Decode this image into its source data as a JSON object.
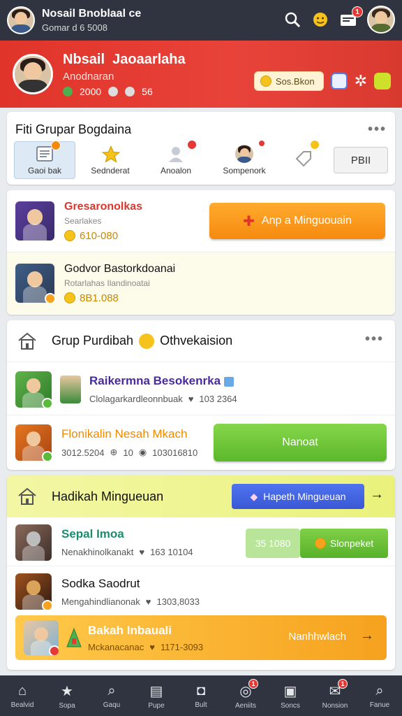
{
  "topbar": {
    "user_name": "Nosail Bnoblaal ce",
    "user_sub": "Gomar d 6 5008",
    "notif_count": "1",
    "icons": [
      "search-icon",
      "emoji-icon",
      "inbox-icon",
      "avatar"
    ]
  },
  "profile": {
    "name": "Nbsail  Jaoaarlaha",
    "subtitle": "Anodnaran",
    "stat1": "2000",
    "stat2": "56",
    "points_label": "Sos.Bkon"
  },
  "section1": {
    "title": "Fiti Grupar Bogdaina",
    "categories": [
      {
        "label": "Gaoi bak",
        "icon": "list-icon",
        "badge": true
      },
      {
        "label": "Sednderat",
        "icon": "star-icon",
        "badge": false
      },
      {
        "label": "Anoalon",
        "icon": "user-icon",
        "badge": true
      },
      {
        "label": "Sompenork",
        "icon": "profile-icon",
        "badge": true
      },
      {
        "label": "",
        "icon": "tag-icon",
        "badge": true
      }
    ],
    "filter_label": "PBII"
  },
  "section2": {
    "row1": {
      "title": "Gresaronolkas",
      "sub": "Searlakes",
      "coins": "610-080",
      "button": "Anp a Minguouain"
    },
    "row2": {
      "title": "Godvor Bastorkdoanai",
      "sub": "Rotarlahas Ilandinoatai",
      "coins": "8B1.088"
    }
  },
  "section3": {
    "title": "Grup Purdibah",
    "title_suffix": "Othvekaision",
    "row1": {
      "title": "Raikermna Besokenrka",
      "sub": "Clolagarkardleonnbuak",
      "value": "103 2364"
    },
    "row2": {
      "title": "Flonikalin Nesah Mkach",
      "value1": "3012.5204",
      "value2": "10",
      "value3": "103016810",
      "button": "Nanoat"
    }
  },
  "section4": {
    "title": "Hadikah Mingueuan",
    "blue_button": "Hapeth Mingueuan",
    "row1": {
      "title": "Sepal Imoa",
      "sub": "Nenakhinolkanakt",
      "value": "163 10104",
      "pale_button": "35 1080",
      "green_button": "Slonpeket"
    },
    "row2": {
      "title": "Sodka Saodrut",
      "sub": "Mengahindlianonak",
      "value": "1303,8033"
    },
    "banner": {
      "title": "Bakah Inbauali",
      "sub": "Mckanacanac",
      "value": "1171-3093",
      "cta": "Nanhhwlach"
    }
  },
  "bottom_nav": [
    {
      "label": "Bealvid",
      "icon": "home-icon",
      "badge": ""
    },
    {
      "label": "Sopa",
      "icon": "star-icon",
      "badge": ""
    },
    {
      "label": "Gaqu",
      "icon": "search-icon",
      "badge": ""
    },
    {
      "label": "Pupe",
      "icon": "image-icon",
      "badge": ""
    },
    {
      "label": "Bult",
      "icon": "camera-icon",
      "badge": ""
    },
    {
      "label": "Aeniits",
      "icon": "chat-icon",
      "badge": "1"
    },
    {
      "label": "Soncs",
      "icon": "grid-icon",
      "badge": ""
    },
    {
      "label": "Nonsion",
      "icon": "message-icon",
      "badge": "1"
    },
    {
      "label": "Fanue",
      "icon": "search-icon",
      "badge": ""
    }
  ],
  "colors": {
    "header_red": "#e0342a",
    "topbar_dark": "#2f3440",
    "orange": "#f68a0f",
    "green": "#5bb82a",
    "blue": "#3a58d6"
  }
}
